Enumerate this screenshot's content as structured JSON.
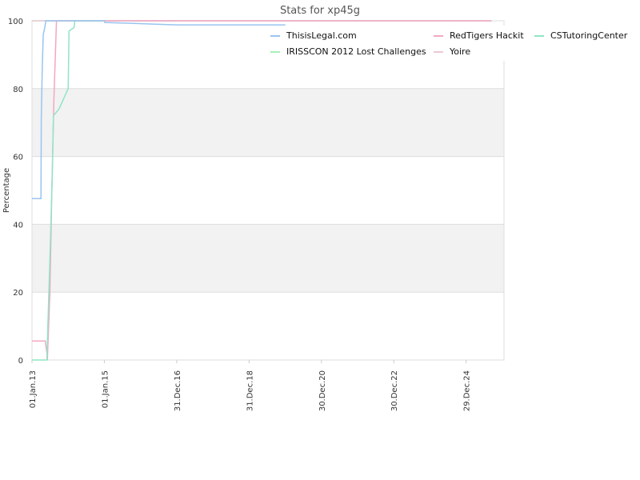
{
  "chart_data": {
    "type": "line",
    "title": "Stats for xp45g",
    "ylabel": "Percentage",
    "xlabel": "",
    "ylim": [
      0,
      100
    ],
    "y_ticks": [
      0,
      20,
      40,
      60,
      80,
      100
    ],
    "x_ticks": [
      "01.Jan.13",
      "01.Jan.15",
      "31.Dec.16",
      "31.Dec.18",
      "30.Dec.20",
      "30.Dec.22",
      "29.Dec.24"
    ],
    "xlim": [
      "2013-01-01",
      "2026-01-15"
    ],
    "grid": true,
    "legend_position": "top-right",
    "series": [
      {
        "name": "ThisisLegal.com",
        "color": "#99c4f0",
        "points": [
          [
            "2013-01-01",
            47.6
          ],
          [
            "2013-04-01",
            47.6
          ],
          [
            "2013-04-05",
            71
          ],
          [
            "2013-04-15",
            87
          ],
          [
            "2013-04-25",
            96
          ],
          [
            "2013-05-10",
            98
          ],
          [
            "2013-05-20",
            100
          ],
          [
            "2015-01-01",
            100
          ],
          [
            "2015-01-05",
            99.5
          ],
          [
            "2015-09-01",
            99.3
          ],
          [
            "2016-06-01",
            99.0
          ],
          [
            "2017-01-01",
            98.8
          ],
          [
            "2020-01-01",
            98.8
          ]
        ]
      },
      {
        "name": "RedTigers Hackit",
        "color": "#f4a6c4",
        "points": [
          [
            "2013-01-01",
            5.6
          ],
          [
            "2013-05-15",
            5.6
          ],
          [
            "2013-06-01",
            2
          ],
          [
            "2013-06-05",
            0
          ],
          [
            "2013-07-01",
            20
          ],
          [
            "2013-07-20",
            50
          ],
          [
            "2013-08-10",
            77
          ],
          [
            "2013-08-25",
            90
          ],
          [
            "2013-09-05",
            100
          ],
          [
            "2025-09-10",
            100
          ]
        ]
      },
      {
        "name": "CSTutoringCenter",
        "color": "#8fe6c4",
        "points": [
          [
            "2013-01-01",
            0
          ],
          [
            "2013-06-01",
            0
          ],
          [
            "2013-06-10",
            10
          ],
          [
            "2013-07-01",
            30
          ],
          [
            "2013-07-25",
            55
          ],
          [
            "2013-08-05",
            72
          ],
          [
            "2013-10-01",
            74
          ],
          [
            "2013-12-01",
            78
          ],
          [
            "2014-01-01",
            80
          ],
          [
            "2014-01-10",
            97
          ],
          [
            "2014-03-01",
            98
          ],
          [
            "2014-03-10",
            100
          ],
          [
            "2015-01-01",
            100
          ]
        ]
      },
      {
        "name": "IRISSCON 2012 Lost Challenges",
        "color": "#a8f0b8",
        "points": [
          [
            "2013-01-01",
            100
          ],
          [
            "2025-09-10",
            100
          ]
        ]
      },
      {
        "name": "Yoire",
        "color": "#ecc8d8",
        "points": [
          [
            "2013-01-01",
            100
          ],
          [
            "2025-09-10",
            100
          ]
        ]
      }
    ]
  }
}
